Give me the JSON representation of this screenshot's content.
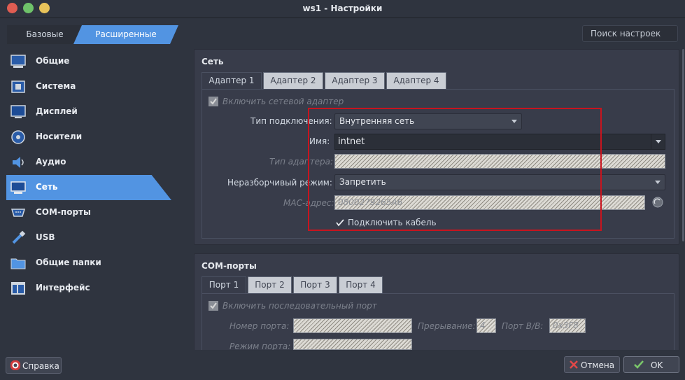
{
  "window": {
    "title": "ws1 - Настройки"
  },
  "modes": {
    "basic": "Базовые",
    "advanced": "Расширенные"
  },
  "search": {
    "placeholder": "Поиск настроек"
  },
  "sidebar": {
    "items": [
      {
        "label": "Общие",
        "icon": "monitor-icon"
      },
      {
        "label": "Система",
        "icon": "chip-icon"
      },
      {
        "label": "Дисплей",
        "icon": "display-icon"
      },
      {
        "label": "Носители",
        "icon": "disk-icon"
      },
      {
        "label": "Аудио",
        "icon": "speaker-icon"
      },
      {
        "label": "Сеть",
        "icon": "network-icon",
        "active": true
      },
      {
        "label": "COM-порты",
        "icon": "serial-port-icon"
      },
      {
        "label": "USB",
        "icon": "usb-icon"
      },
      {
        "label": "Общие папки",
        "icon": "folder-icon"
      },
      {
        "label": "Интерфейс",
        "icon": "interface-icon"
      }
    ]
  },
  "network": {
    "title": "Сеть",
    "tabs": [
      "Адаптер 1",
      "Адаптер 2",
      "Адаптер 3",
      "Адаптер 4"
    ],
    "enable_label": "Включить сетевой адаптер",
    "attach_label": "Тип подключения:",
    "attach_value": "Внутренняя сеть",
    "name_label": "Имя:",
    "name_value": "intnet",
    "adapter_type_label": "Тип адаптера:",
    "promisc_label": "Неразборчивый режим:",
    "promisc_value": "Запретить",
    "mac_label": "MAC-адрес:",
    "mac_value": "0800279265A6",
    "cable_label": "Подключить кабель"
  },
  "com": {
    "title": "COM-порты",
    "tabs": [
      "Порт 1",
      "Порт 2",
      "Порт 3",
      "Порт 4"
    ],
    "enable_label": "Включить последовательный порт",
    "port_number_label": "Номер порта:",
    "irq_label": "Прерывание:",
    "irq_value": "4",
    "io_label": "Порт В/В:",
    "io_value": "0x3F8",
    "mode_label": "Режим порта:"
  },
  "buttons": {
    "help": "Справка",
    "cancel": "Отмена",
    "ok": "OK"
  },
  "colors": {
    "accent": "#5294e2",
    "highlight": "#c8141e"
  }
}
